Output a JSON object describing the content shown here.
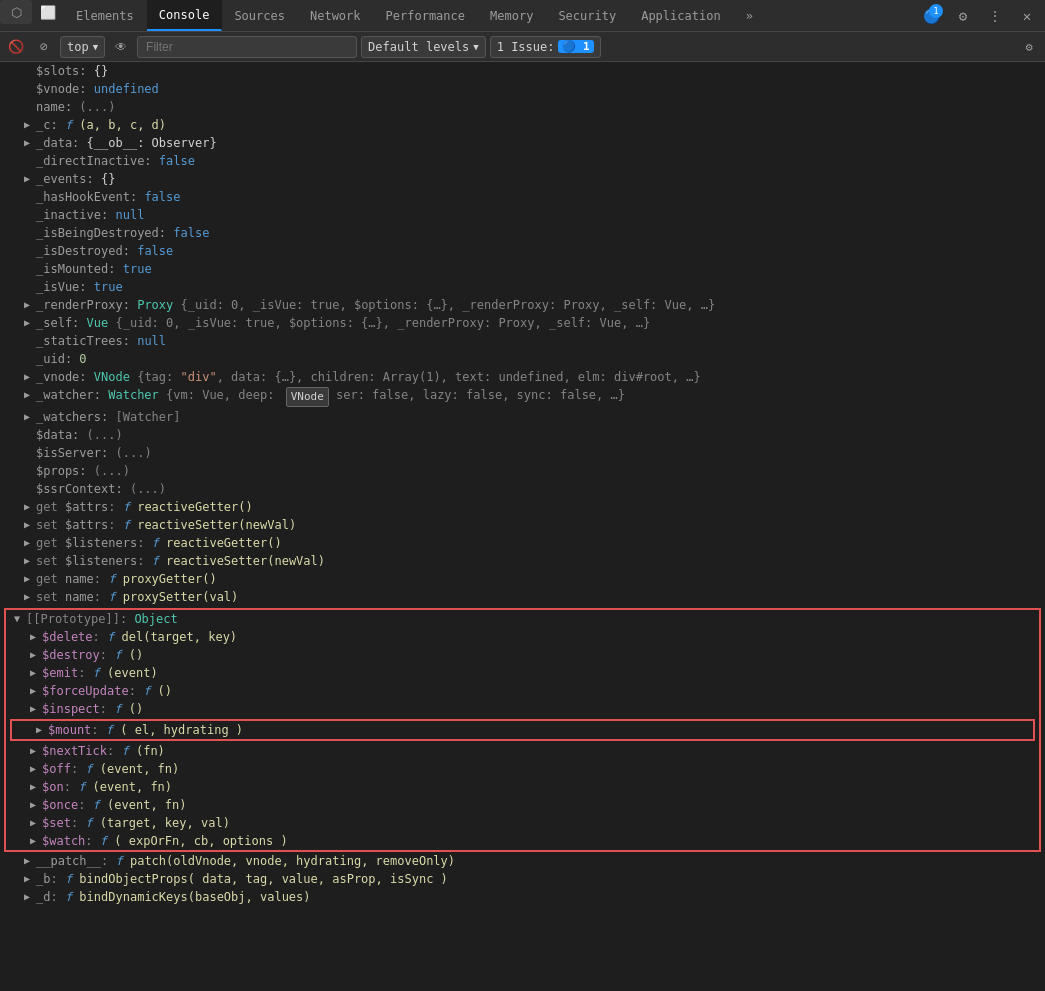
{
  "tabs": [
    {
      "label": "Elements",
      "active": false
    },
    {
      "label": "Console",
      "active": true
    },
    {
      "label": "Sources",
      "active": false
    },
    {
      "label": "Network",
      "active": false
    },
    {
      "label": "Performance",
      "active": false
    },
    {
      "label": "Memory",
      "active": false
    },
    {
      "label": "Security",
      "active": false
    },
    {
      "label": "Application",
      "active": false
    }
  ],
  "toolbar": {
    "context": "top",
    "filter_placeholder": "Filter",
    "levels_label": "Default levels",
    "issue_label": "1 Issue:",
    "issue_count": "1"
  },
  "console_lines": [
    {
      "indent": 1,
      "arrow": "none",
      "content": "$slots: {}"
    },
    {
      "indent": 1,
      "arrow": "none",
      "content": "$vnode: undefined"
    },
    {
      "indent": 1,
      "arrow": "none",
      "content": "name: (...)"
    },
    {
      "indent": 1,
      "arrow": "collapsed",
      "content": "_c: f (a, b, c, d)"
    },
    {
      "indent": 1,
      "arrow": "collapsed",
      "content": "_data: {__ob__: Observer}"
    },
    {
      "indent": 1,
      "arrow": "none",
      "content": "_directInactive: false"
    },
    {
      "indent": 1,
      "arrow": "collapsed",
      "content": "_events: {}"
    },
    {
      "indent": 1,
      "arrow": "none",
      "content": "_hasHookEvent: false"
    },
    {
      "indent": 1,
      "arrow": "none",
      "content": "_inactive: null"
    },
    {
      "indent": 1,
      "arrow": "none",
      "content": "_isBeingDestroyed: false"
    },
    {
      "indent": 1,
      "arrow": "none",
      "content": "_isDestroyed: false"
    },
    {
      "indent": 1,
      "arrow": "none",
      "content": "_isMounted: true"
    },
    {
      "indent": 1,
      "arrow": "none",
      "content": "_isVue: true"
    },
    {
      "indent": 1,
      "arrow": "collapsed",
      "content": "_renderProxy: Proxy {_uid: 0, _isVue: true, $options: {…}, _renderProxy: Proxy, _self: Vue, …}"
    },
    {
      "indent": 1,
      "arrow": "collapsed",
      "content": "_self: Vue {_uid: 0, _isVue: true, $options: {…}, _renderProxy: Proxy, _self: Vue, …}"
    },
    {
      "indent": 1,
      "arrow": "none",
      "content": "_staticTrees: null"
    },
    {
      "indent": 1,
      "arrow": "none",
      "content": "_uid: 0"
    },
    {
      "indent": 1,
      "arrow": "collapsed",
      "content": "_vnode: VNode {tag: \"div\", data: {…}, children: Array(1), text: undefined, elm: div#root, …}"
    },
    {
      "indent": 1,
      "arrow": "collapsed",
      "content": "_watcher: Watcher {vm: Vue, deep:  VNode ser: false, lazy: false, sync: false, …}"
    },
    {
      "indent": 1,
      "arrow": "collapsed",
      "content": "_watchers: [Watcher]"
    },
    {
      "indent": 1,
      "arrow": "none",
      "content": "$data: (...)"
    },
    {
      "indent": 1,
      "arrow": "none",
      "content": "$isServer: (...)"
    },
    {
      "indent": 1,
      "arrow": "none",
      "content": "$props: (...)"
    },
    {
      "indent": 1,
      "arrow": "none",
      "content": "$ssrContext: (...)"
    },
    {
      "indent": 1,
      "arrow": "collapsed",
      "content": "get $attrs: f reactiveGetter()"
    },
    {
      "indent": 1,
      "arrow": "collapsed",
      "content": "set $attrs: f reactiveSetter(newVal)"
    },
    {
      "indent": 1,
      "arrow": "collapsed",
      "content": "get $listeners: f reactiveGetter()"
    },
    {
      "indent": 1,
      "arrow": "collapsed",
      "content": "set $listeners: f reactiveSetter(newVal)"
    },
    {
      "indent": 1,
      "arrow": "collapsed",
      "content": "get name: f proxyGetter()"
    },
    {
      "indent": 1,
      "arrow": "collapsed",
      "content": "set name: f proxySetter(val)"
    },
    {
      "indent": 0,
      "arrow": "expanded",
      "content": "[[Prototype]]: Object",
      "highlight_outer": true
    },
    {
      "indent": 1,
      "arrow": "collapsed",
      "content": "$delete: f del(target, key)",
      "highlight_outer": true
    },
    {
      "indent": 1,
      "arrow": "collapsed",
      "content": "$destroy: f ()",
      "highlight_outer": true
    },
    {
      "indent": 1,
      "arrow": "collapsed",
      "content": "$emit: f (event)",
      "highlight_outer": true
    },
    {
      "indent": 1,
      "arrow": "collapsed",
      "content": "$forceUpdate: f ()",
      "highlight_outer": true
    },
    {
      "indent": 1,
      "arrow": "collapsed",
      "content": "$inspect: f ()",
      "highlight_outer": true
    },
    {
      "indent": 1,
      "arrow": "collapsed",
      "content": "$mount: f ( el, hydrating )",
      "highlight_inner": true
    },
    {
      "indent": 1,
      "arrow": "collapsed",
      "content": "$nextTick: f (fn)",
      "highlight_outer": true
    },
    {
      "indent": 1,
      "arrow": "collapsed",
      "content": "$off: f (event, fn)",
      "highlight_outer": true
    },
    {
      "indent": 1,
      "arrow": "collapsed",
      "content": "$on: f (event, fn)",
      "highlight_outer": true
    },
    {
      "indent": 1,
      "arrow": "collapsed",
      "content": "$once: f (event, fn)",
      "highlight_outer": true
    },
    {
      "indent": 1,
      "arrow": "collapsed",
      "content": "$set: f (target, key, val)",
      "highlight_outer": true
    },
    {
      "indent": 1,
      "arrow": "collapsed",
      "content": "$watch: f ( expOrFn, cb, options )",
      "highlight_outer": true
    },
    {
      "indent": 1,
      "arrow": "collapsed",
      "content": "__patch__: f patch(oldVnode, vnode, hydrating, removeOnly)"
    },
    {
      "indent": 1,
      "arrow": "collapsed",
      "content": "_b: f bindObjectProps( data, tag, value, asProp, isSync )"
    },
    {
      "indent": 1,
      "arrow": "collapsed",
      "content": "_d: f bindDynamicKeys(baseObj, values)"
    }
  ]
}
